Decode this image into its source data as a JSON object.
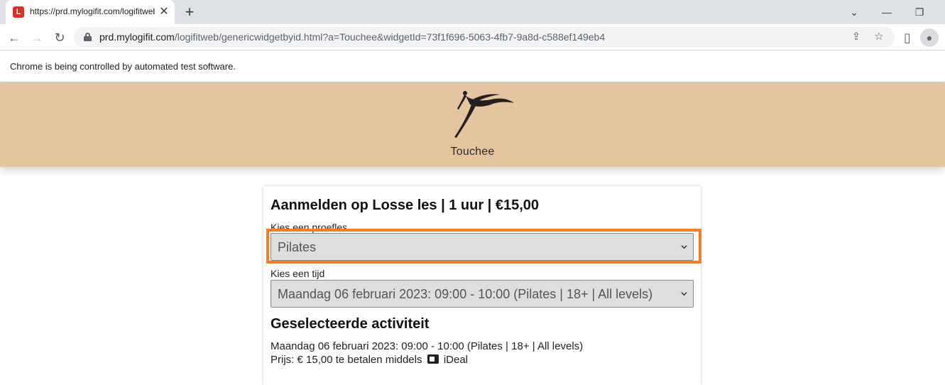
{
  "browser": {
    "tab": {
      "favicon_letter": "L",
      "title": "https://prd.mylogifit.com/logifitweb",
      "close_glyph": "✕"
    },
    "new_tab_glyph": "+",
    "window_controls": {
      "tabsearch_glyph": "⌄",
      "minimize_glyph": "—",
      "restore_glyph": "❐"
    },
    "nav": {
      "back_glyph": "←",
      "forward_glyph": "→",
      "reload_glyph": "↻"
    },
    "url": {
      "host": "prd.mylogifit.com",
      "path": "/logifitweb/genericwidgetbyid.html?a=Touchee&widgetId=73f1f696-5063-4fb7-9a8d-c588ef149eb4"
    },
    "omnibox_icons": {
      "share_glyph": "⇪",
      "bookmark_glyph": "☆",
      "sidepanel_glyph": "▯",
      "profile_glyph": "●"
    },
    "infobar_text": "Chrome is being controlled by automated test software."
  },
  "header": {
    "brand_name": "Touchee",
    "logo_color": "#231f20",
    "background_color": "#e4c59f"
  },
  "form": {
    "title": "Aanmelden op Losse les | 1 uur | €15,00",
    "lesson_label": "Kies een proefles",
    "lesson_value": "Pilates",
    "time_label": "Kies een tijd",
    "time_value": "Maandag 06 februari 2023: 09:00 - 10:00 (Pilates | 18+ | All levels)",
    "highlight_color": "#f47d26"
  },
  "selected": {
    "title": "Geselecteerde activiteit",
    "activity": "Maandag 06 februari 2023: 09:00 - 10:00 (Pilates | 18+ | All levels)",
    "price_prefix": "Prijs: € 15,00 te betalen middels",
    "payment_method": "iDeal"
  }
}
